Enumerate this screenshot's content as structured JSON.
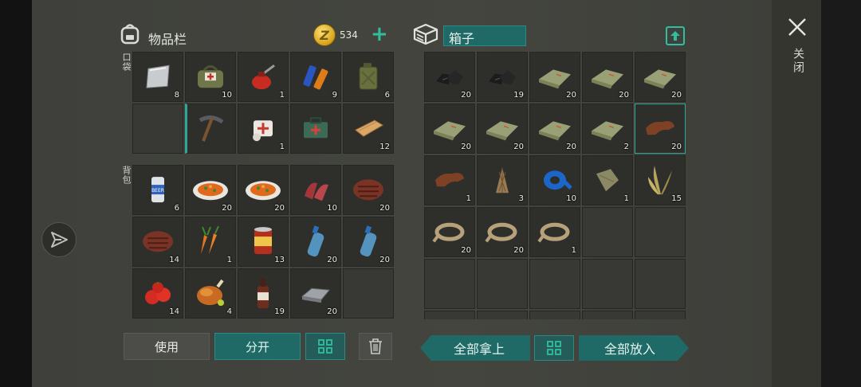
{
  "header": {
    "inventory_title": "物品栏",
    "coins": "534",
    "box_name": "箱子",
    "close_label": "关闭"
  },
  "sections": {
    "pocket_label": "口袋",
    "backpack_label": "背包"
  },
  "pocket": [
    {
      "item": "metal-sheet",
      "count": "8"
    },
    {
      "item": "medical-bag",
      "count": "10"
    },
    {
      "item": "oil-can",
      "count": "1"
    },
    {
      "item": "batteries",
      "count": "9"
    },
    {
      "item": "jerrycan",
      "count": "6"
    },
    {
      "item": "",
      "count": ""
    },
    {
      "item": "pickaxe",
      "count": ""
    },
    {
      "item": "bandage",
      "count": "1"
    },
    {
      "item": "first-aid-kit",
      "count": ""
    },
    {
      "item": "wooden-plank",
      "count": "12"
    }
  ],
  "backpack": [
    {
      "item": "beer-can",
      "count": "6"
    },
    {
      "item": "vegetable-stew",
      "count": "20"
    },
    {
      "item": "vegetable-stew",
      "count": "20"
    },
    {
      "item": "raw-meat-strips",
      "count": "10"
    },
    {
      "item": "steak",
      "count": "20"
    },
    {
      "item": "steak",
      "count": "14"
    },
    {
      "item": "carrots",
      "count": "1"
    },
    {
      "item": "canned-food",
      "count": "13"
    },
    {
      "item": "water-bottle",
      "count": "20"
    },
    {
      "item": "water-bottle",
      "count": "20"
    },
    {
      "item": "tomatoes",
      "count": "14"
    },
    {
      "item": "roast-chicken",
      "count": "4"
    },
    {
      "item": "sauce-bottle",
      "count": "19"
    },
    {
      "item": "iron-ingot",
      "count": "20"
    },
    {
      "item": "",
      "count": ""
    }
  ],
  "box": [
    {
      "item": "coal",
      "count": "20"
    },
    {
      "item": "coal",
      "count": "19"
    },
    {
      "item": "cloth",
      "count": "20"
    },
    {
      "item": "cloth",
      "count": "20"
    },
    {
      "item": "cloth",
      "count": "20"
    },
    {
      "item": "cloth",
      "count": "20"
    },
    {
      "item": "cloth",
      "count": "20"
    },
    {
      "item": "cloth",
      "count": "20"
    },
    {
      "item": "cloth",
      "count": "2"
    },
    {
      "item": "leather",
      "count": "20"
    },
    {
      "item": "leather",
      "count": "1"
    },
    {
      "item": "fiber-bundle",
      "count": "3"
    },
    {
      "item": "duct-tape",
      "count": "10"
    },
    {
      "item": "canvas-patch",
      "count": "1"
    },
    {
      "item": "plant-leaves",
      "count": "15"
    },
    {
      "item": "rope",
      "count": "20"
    },
    {
      "item": "rope",
      "count": "20"
    },
    {
      "item": "rope",
      "count": "1"
    },
    {
      "item": "",
      "count": ""
    },
    {
      "item": "",
      "count": ""
    },
    {
      "item": "",
      "count": ""
    },
    {
      "item": "",
      "count": ""
    },
    {
      "item": "",
      "count": ""
    },
    {
      "item": "",
      "count": ""
    },
    {
      "item": "",
      "count": ""
    },
    {
      "item": "",
      "count": ""
    },
    {
      "item": "",
      "count": ""
    },
    {
      "item": "",
      "count": ""
    },
    {
      "item": "",
      "count": ""
    },
    {
      "item": "",
      "count": ""
    }
  ],
  "buttons": {
    "use": "使用",
    "split": "分开",
    "take_all": "全部拿上",
    "put_all": "全部放入"
  },
  "colors": {
    "accent": "#2fbf9e",
    "teal_button": "#1f6a66",
    "panel": "#44453f",
    "slot": "#2e2f2b"
  }
}
